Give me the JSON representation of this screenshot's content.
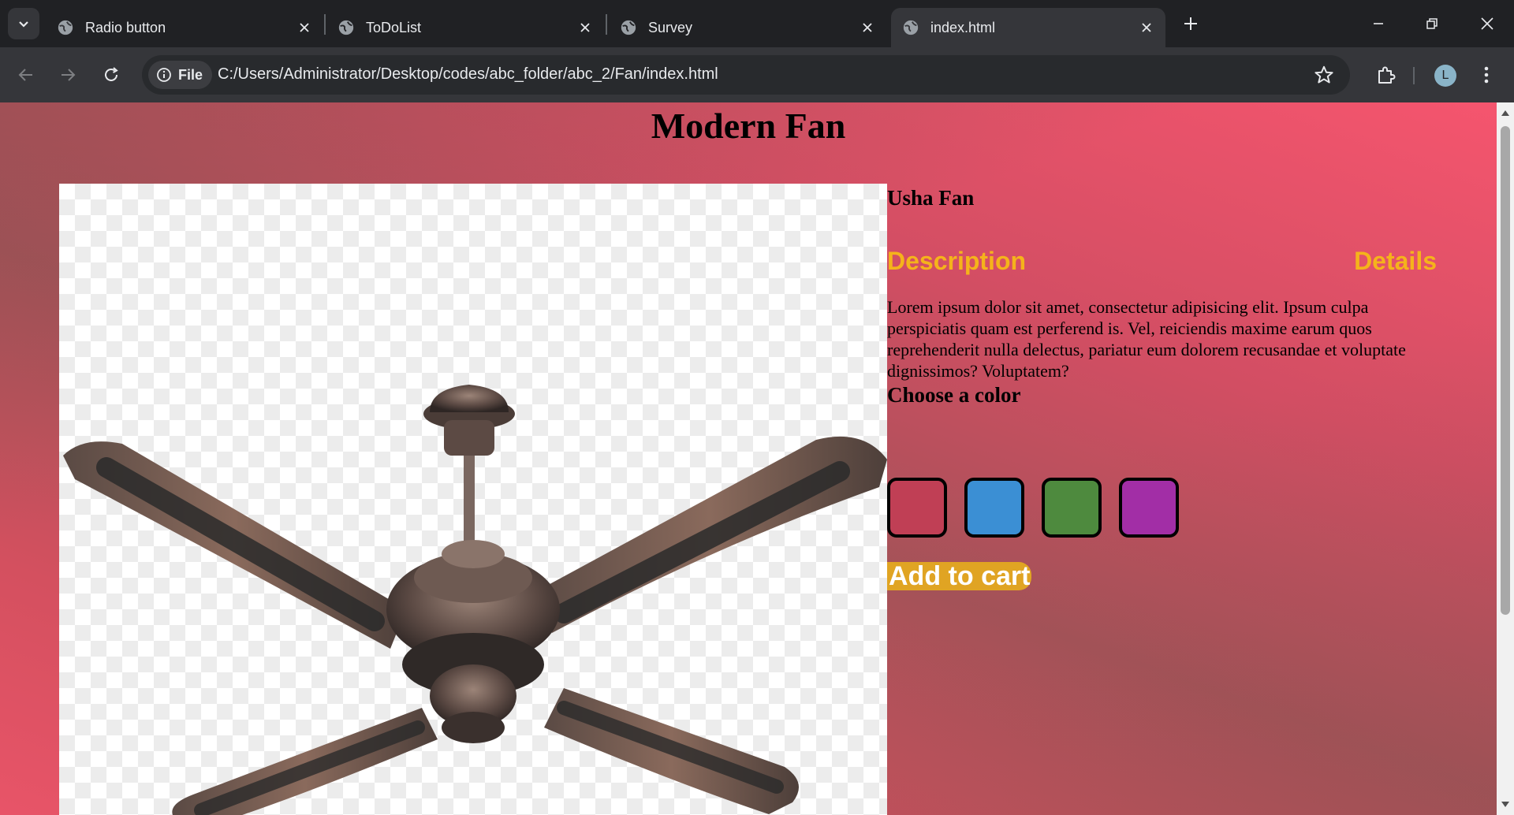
{
  "browser": {
    "tabs": [
      {
        "title": "Radio button",
        "active": false
      },
      {
        "title": "ToDoList",
        "active": false
      },
      {
        "title": "Survey",
        "active": false
      },
      {
        "title": "index.html",
        "active": true
      }
    ],
    "site_chip": "File",
    "url": "C:/Users/Administrator/Desktop/codes/abc_folder/abc_2/Fan/index.html",
    "profile_initial": "L"
  },
  "page": {
    "title": "Modern Fan",
    "product_name": "Usha Fan",
    "tabs": {
      "description": "Description",
      "details": "Details"
    },
    "description": "Lorem ipsum dolor sit amet, consectetur adipisicing elit. Ipsum culpa perspiciatis quam est perferend is. Vel, reiciendis maxime earum quos reprehenderit nulla delectus, pariatur eum dolorem recusandae et voluptate dignissimos? Voluptatem?",
    "choose_color_label": "Choose a color",
    "colors": [
      "#c03f55",
      "#3b8fd4",
      "#4e8a3e",
      "#a22ea6"
    ],
    "add_to_cart": "Add to cart",
    "accent_color": "#f5b31b"
  }
}
